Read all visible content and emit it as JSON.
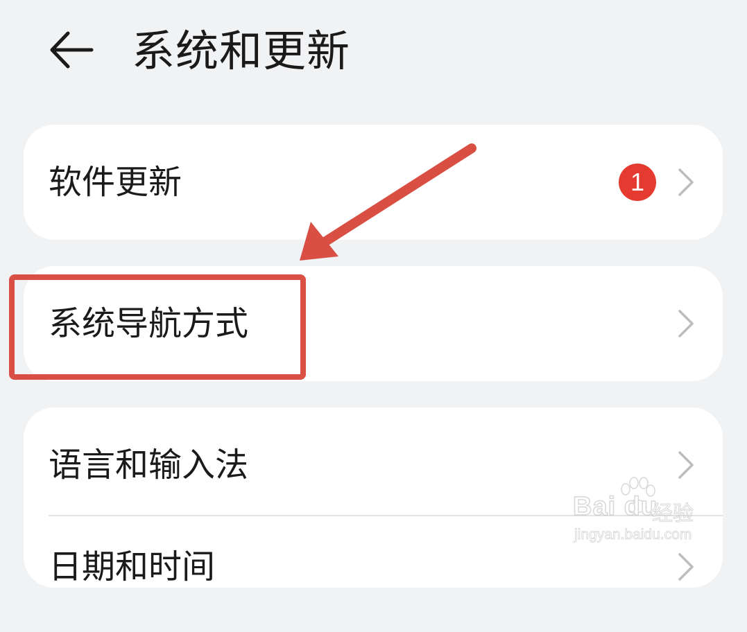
{
  "header": {
    "back_icon": "arrow-left-icon",
    "title": "系统和更新"
  },
  "settings": {
    "software_update": {
      "label": "软件更新",
      "badge_count": "1",
      "badge_color": "#e53a2f",
      "chevron_icon": "chevron-right-icon"
    },
    "navigation_mode": {
      "label": "系统导航方式",
      "chevron_icon": "chevron-right-icon"
    },
    "language_input": {
      "label": "语言和输入法",
      "chevron_icon": "chevron-right-icon"
    },
    "date_time": {
      "label": "日期和时间",
      "chevron_icon": "chevron-right-icon"
    }
  },
  "annotation": {
    "color": "#d94f44",
    "arrow_icon": "annotation-arrow",
    "highlight": "highlight-box"
  },
  "watermark": {
    "logo": "Bai du",
    "brand_cn": "经验",
    "url": "jingyan.baidu.com"
  },
  "colors": {
    "background": "#f1f2f4",
    "card": "#ffffff",
    "text": "#1a1a1a",
    "chevron": "#bdbdbd"
  }
}
